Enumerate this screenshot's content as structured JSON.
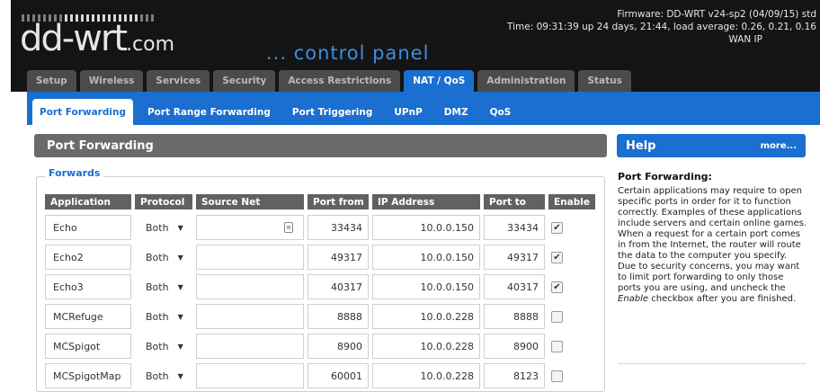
{
  "header": {
    "logo_text": "dd-wrt",
    "logo_suffix": ".com",
    "subtitle": "... control panel",
    "firmware": "Firmware: DD-WRT v24-sp2 (04/09/15) std",
    "time": "Time: 09:31:39 up 24 days, 21:44, load average: 0.26, 0.21, 0.16",
    "wan_ip": "WAN IP"
  },
  "main_tabs": [
    {
      "label": "Setup"
    },
    {
      "label": "Wireless"
    },
    {
      "label": "Services"
    },
    {
      "label": "Security"
    },
    {
      "label": "Access Restrictions"
    },
    {
      "label": "NAT / QoS"
    },
    {
      "label": "Administration"
    },
    {
      "label": "Status"
    }
  ],
  "sub_tabs": [
    {
      "label": "Port Forwarding"
    },
    {
      "label": "Port Range Forwarding"
    },
    {
      "label": "Port Triggering"
    },
    {
      "label": "UPnP"
    },
    {
      "label": "DMZ"
    },
    {
      "label": "QoS"
    }
  ],
  "section": {
    "title": "Port Forwarding",
    "forwards_legend": "Forwards"
  },
  "table": {
    "headers": {
      "application": "Application",
      "protocol": "Protocol",
      "source_net": "Source Net",
      "port_from": "Port from",
      "ip_address": "IP Address",
      "port_to": "Port to",
      "enable": "Enable"
    },
    "rows": [
      {
        "application": "Echo",
        "protocol": "Both",
        "source_net": "",
        "port_from": "33434",
        "ip_address": "10.0.0.150",
        "port_to": "33434",
        "enabled": true
      },
      {
        "application": "Echo2",
        "protocol": "Both",
        "source_net": "",
        "port_from": "49317",
        "ip_address": "10.0.0.150",
        "port_to": "49317",
        "enabled": true
      },
      {
        "application": "Echo3",
        "protocol": "Both",
        "source_net": "",
        "port_from": "40317",
        "ip_address": "10.0.0.150",
        "port_to": "40317",
        "enabled": true
      },
      {
        "application": "MCRefuge",
        "protocol": "Both",
        "source_net": "",
        "port_from": "8888",
        "ip_address": "10.0.0.228",
        "port_to": "8888",
        "enabled": false
      },
      {
        "application": "MCSpigot",
        "protocol": "Both",
        "source_net": "",
        "port_from": "8900",
        "ip_address": "10.0.0.228",
        "port_to": "8900",
        "enabled": false
      },
      {
        "application": "MCSpigotMap",
        "protocol": "Both",
        "source_net": "",
        "port_from": "60001",
        "ip_address": "10.0.0.228",
        "port_to": "8123",
        "enabled": false
      }
    ]
  },
  "help": {
    "title": "Help",
    "more": "more...",
    "topic": "Port Forwarding:",
    "body_1": "Certain applications may require to open specific ports in order for it to function correctly. Examples of these applications include servers and certain online games. When a request for a certain port comes in from the Internet, the router will route the data to the computer you specify. Due to security concerns, you may want to limit port forwarding to only those ports you are using, and uncheck the ",
    "body_em": "Enable",
    "body_2": " checkbox after you are finished."
  },
  "colors": {
    "accent": "#1a6fd0",
    "header_bg": "#141414",
    "tab_bg": "#4b4b4b",
    "section_header_bg": "#6a6a6a",
    "table_header_bg": "#616161"
  }
}
